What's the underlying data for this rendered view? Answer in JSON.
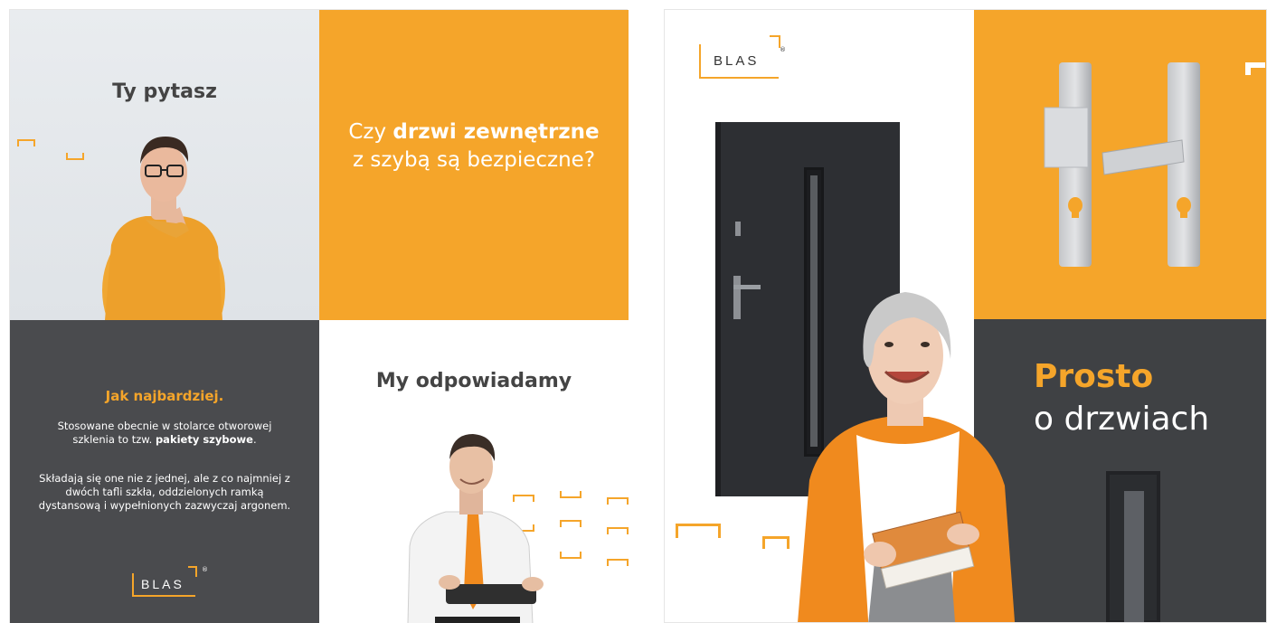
{
  "left_panel": {
    "question_title": "Ty pytasz",
    "question_text": {
      "part1": "Czy ",
      "bold1": "drzwi zewnętrzne",
      "part2": " z szybą są bezpieczne?"
    },
    "answer_heading": "Jak najbardziej.",
    "answer_p1_text": "Stosowane obecnie w stolarce otworowej szklenia to tzw. ",
    "answer_p1_bold": "pakiety szybowe",
    "answer_p1_end": ".",
    "answer_p2": "Składają się one nie z jednej, ale z co najmniej z dwóch tafli szkła, oddzielonych ramką dystansową i wypełnionych zazwyczaj argonem.",
    "logo_text": "BLAS",
    "logo_reg": "®",
    "reply_title": "My odpowiadamy"
  },
  "right_panel": {
    "logo_text": "BLAS",
    "logo_reg": "®",
    "headline_bold": "Prosto",
    "headline_regular": "o drzwiach"
  },
  "colors": {
    "accent": "#f5a52a",
    "dark": "#4a4b4e",
    "dark2": "#3f4144"
  }
}
